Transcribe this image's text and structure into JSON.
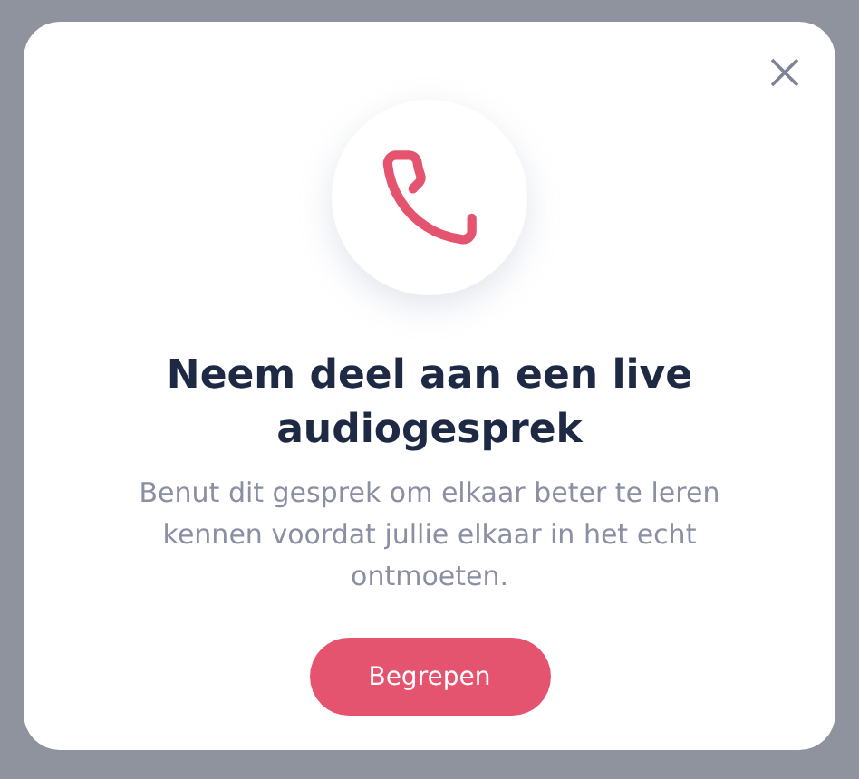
{
  "dialog": {
    "title": "Neem deel aan een live audiogesprek",
    "message": "Benut dit gesprek om elkaar beter te leren kennen voordat jullie elkaar in het echt ontmoeten.",
    "button": "Begrepen"
  }
}
